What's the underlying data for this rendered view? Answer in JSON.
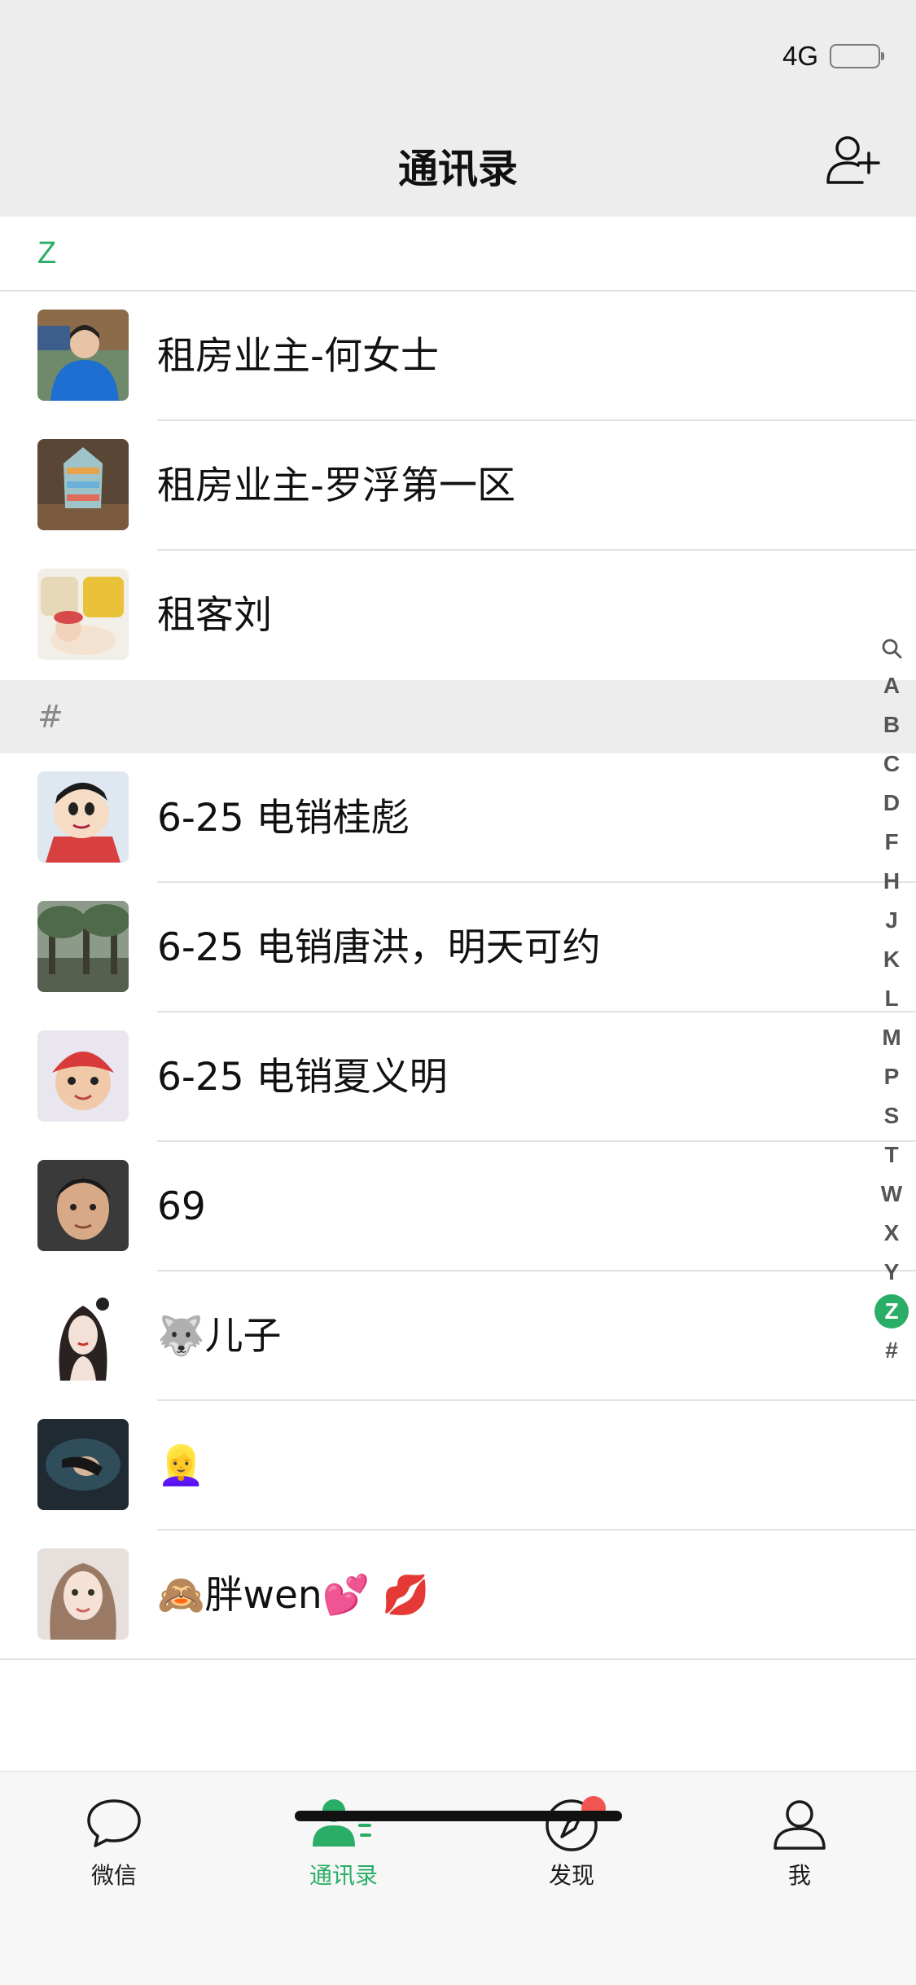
{
  "status_bar": {
    "network": "4G"
  },
  "header": {
    "title": "通讯录"
  },
  "sections": [
    {
      "letter": "Z",
      "contacts": [
        {
          "name": "租房业主-何女士"
        },
        {
          "name": "租房业主-罗浮第一区"
        },
        {
          "name": "租客刘"
        }
      ]
    },
    {
      "letter": "#",
      "contacts": [
        {
          "name": "6-25 电销桂彪"
        },
        {
          "name": "6-25 电销唐洪，明天可约"
        },
        {
          "name": "6-25 电销夏义明"
        },
        {
          "name": "69"
        },
        {
          "name": "🐺儿子"
        },
        {
          "name": "👱‍♀️"
        },
        {
          "name": "🙈胖wen💕 💋"
        }
      ]
    }
  ],
  "index_bar": [
    "A",
    "B",
    "C",
    "D",
    "F",
    "H",
    "J",
    "K",
    "L",
    "M",
    "P",
    "S",
    "T",
    "W",
    "X",
    "Y",
    "Z",
    "#"
  ],
  "index_active": "Z",
  "tabs": [
    {
      "label": "微信",
      "icon": "chat-bubble-icon"
    },
    {
      "label": "通讯录",
      "icon": "contacts-icon",
      "active": true
    },
    {
      "label": "发现",
      "icon": "compass-icon",
      "badge": true
    },
    {
      "label": "我",
      "icon": "person-icon"
    }
  ],
  "colors": {
    "accent": "#2aae67",
    "badge": "#f25550",
    "header_bg": "#ededed"
  }
}
